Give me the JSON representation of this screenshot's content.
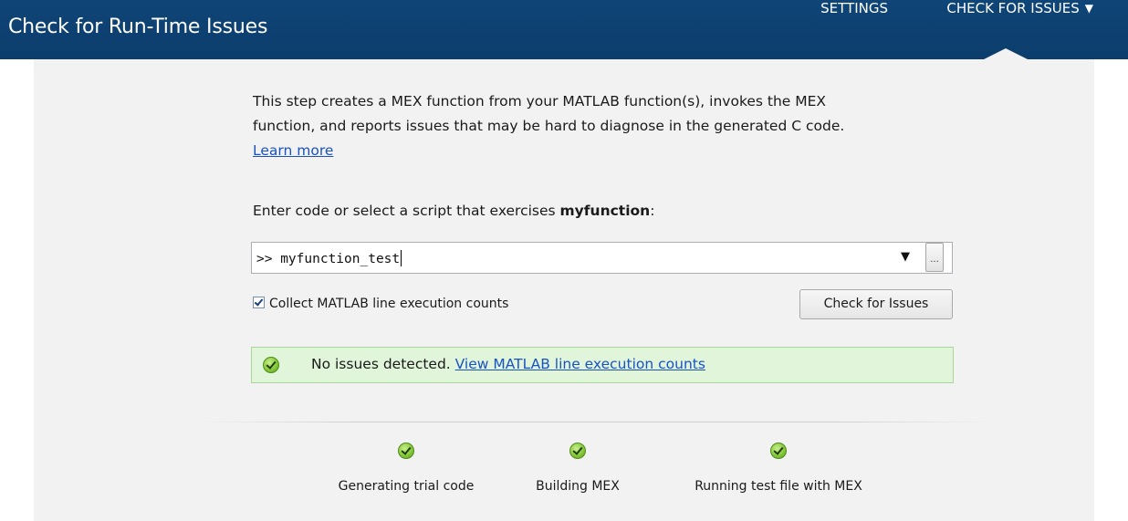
{
  "header": {
    "title": "Check for Run-Time Issues",
    "nav": {
      "settings": "SETTINGS",
      "check_for_issues": "CHECK FOR ISSUES",
      "caret": "▼"
    }
  },
  "description": {
    "line1": "This step creates a MEX function from your MATLAB function(s), invokes the MEX",
    "line2": "function, and reports issues that may be hard to diagnose in the generated C code.",
    "learn_more": "Learn more"
  },
  "prompt": {
    "prefix": "Enter code or select a script that exercises ",
    "function_name": "myfunction",
    "suffix": ":"
  },
  "code_input": {
    "value": ">> myfunction_test",
    "dropdown_glyph": "▼",
    "enter_glyph": "↵",
    "browse_label": "..."
  },
  "options": {
    "collect_counts_label": "Collect MATLAB line execution counts",
    "collect_counts_checked": true
  },
  "actions": {
    "check_button": "Check for Issues"
  },
  "result": {
    "status_text": "No issues detected. ",
    "link_text": "View MATLAB line execution counts",
    "color": "#e0f5d9"
  },
  "steps": [
    {
      "label": "Generating trial code",
      "status": "check-icon"
    },
    {
      "label": "Building MEX",
      "status": "check-icon"
    },
    {
      "label": "Running test file with MEX",
      "status": "check-icon"
    }
  ],
  "colors": {
    "header_bg": "#0f4577",
    "panel_bg": "#f2f2f2",
    "link": "#1a52c4"
  }
}
